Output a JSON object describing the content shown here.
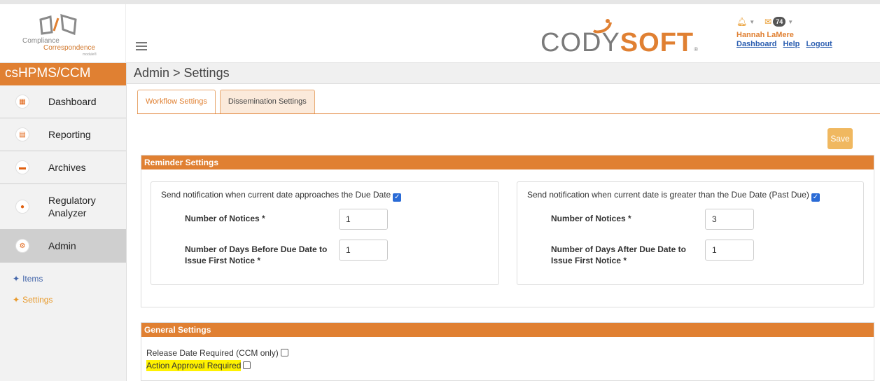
{
  "header": {
    "logo": {
      "line1": "Compliance",
      "line2": "Correspondence",
      "line3": "module®"
    },
    "brand": {
      "part1": "CODY",
      "part2": "SOFT",
      "reg": "®"
    },
    "notifications": {
      "message_count": "74"
    },
    "user": {
      "name": "Hannah LaMere"
    },
    "links": {
      "dashboard": "Dashboard",
      "help": "Help",
      "logout": "Logout"
    }
  },
  "sidebar": {
    "app_title": "csHPMS/CCM",
    "items": [
      {
        "label": "Dashboard",
        "icon": "grid-icon"
      },
      {
        "label": "Reporting",
        "icon": "report-icon"
      },
      {
        "label": "Archives",
        "icon": "folder-icon"
      },
      {
        "label": "Regulatory Analyzer",
        "icon": "people-icon"
      },
      {
        "label": "Admin",
        "icon": "gear-icon",
        "active": true
      }
    ],
    "sub_items": [
      {
        "label": "Items"
      },
      {
        "label": "Settings",
        "selected": true
      }
    ]
  },
  "main": {
    "breadcrumb": "Admin > Settings",
    "tabs": [
      {
        "label": "Workflow Settings",
        "active": true
      },
      {
        "label": "Dissemination Settings"
      }
    ],
    "save_label": "Save",
    "reminder": {
      "title": "Reminder Settings",
      "left": {
        "heading": "Send notification when current date approaches the Due Date",
        "checked": true,
        "notices_label": "Number of Notices *",
        "notices_value": "1",
        "days_label": "Number of Days Before Due Date to Issue First Notice *",
        "days_value": "1"
      },
      "right": {
        "heading": "Send notification when current date is greater than the Due Date (Past Due)",
        "checked": true,
        "notices_label": "Number of Notices *",
        "notices_value": "3",
        "days_label": "Number of Days After Due Date to Issue First Notice *",
        "days_value": "1"
      }
    },
    "general": {
      "title": "General Settings",
      "release_date_label": "Release Date Required (CCM only)",
      "release_date_checked": false,
      "action_approval_label": "Action Approval Required",
      "action_approval_checked": false
    }
  },
  "colors": {
    "accent": "#e08032",
    "link": "#2a5db0",
    "checkbox": "#2a6bd6",
    "highlight": "#fff200"
  }
}
